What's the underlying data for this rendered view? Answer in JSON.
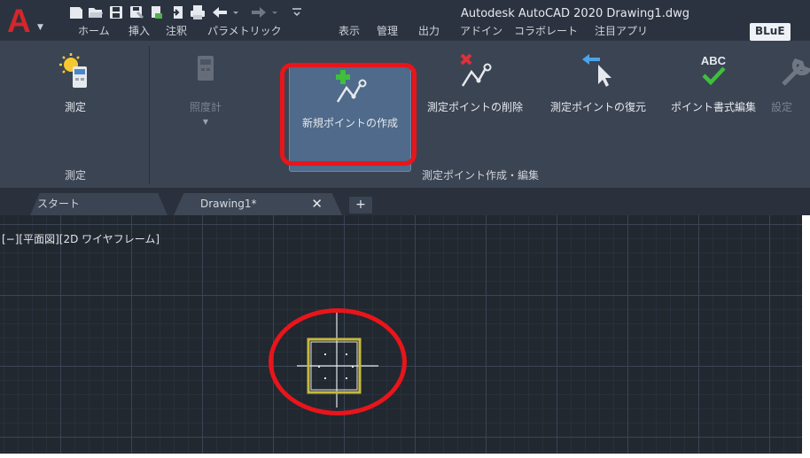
{
  "app": {
    "logo_letter": "A",
    "window_title": "Autodesk AutoCAD 2020    Drawing1.dwg"
  },
  "quick_access": [
    "new-icon",
    "open-icon",
    "save-icon",
    "saveas-icon",
    "web-icon",
    "import-icon",
    "plot-icon",
    "undo-icon",
    "redo-icon",
    "customize-icon"
  ],
  "ribbon_tabs": [
    "ホーム",
    "挿入",
    "注釈",
    "パラメトリック",
    "表示",
    "管理",
    "出力",
    "アドイン",
    "コラボレート",
    "注目アプリ",
    "BLuE"
  ],
  "ribbon": {
    "panel_measure": {
      "title": "測定",
      "button": "測定"
    },
    "panel_points": {
      "title": "測定ポイント作成・編集",
      "buttons": {
        "illuminance": "照度計",
        "new_point": "新規ポイントの作成",
        "delete_point": "測定ポイントの削除",
        "restore_point": "測定ポイントの復元",
        "point_format": "ポイント書式編集",
        "settings": "設定"
      }
    }
  },
  "file_tabs": {
    "start": "スタート",
    "drawing": "Drawing1*",
    "close": "✕",
    "new": "+"
  },
  "viewport": {
    "label": "[−][平面図][2D ワイヤフレーム]"
  },
  "colors": {
    "highlight": "#e8151b",
    "logo": "#d4262b",
    "ribbon_bg": "#3b4453",
    "canvas_bg": "#212830"
  }
}
